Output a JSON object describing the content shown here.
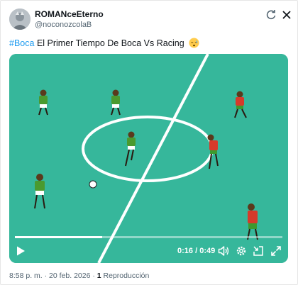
{
  "post": {
    "display_name": "ROMANceEterno",
    "handle": "@noconozcolaB",
    "hashtag": "#Boca",
    "text": "El Primer Tiempo De Boca Vs Racing",
    "emoji_icon": "sleepy-face-icon"
  },
  "header_icons": [
    "refresh-icon",
    "close-icon"
  ],
  "video": {
    "current_time": "0:16",
    "separator": "/",
    "duration": "0:49",
    "progress": 0.326,
    "pitch_color": "#36b79b",
    "controls": [
      "play-icon",
      "volume-icon",
      "settings-icon",
      "pip-icon",
      "fullscreen-icon"
    ]
  },
  "meta": {
    "time": "8:58 p. m.",
    "sep": "·",
    "date": "20 feb. 2026",
    "views_count": "1",
    "views_label": "Reproducción"
  }
}
